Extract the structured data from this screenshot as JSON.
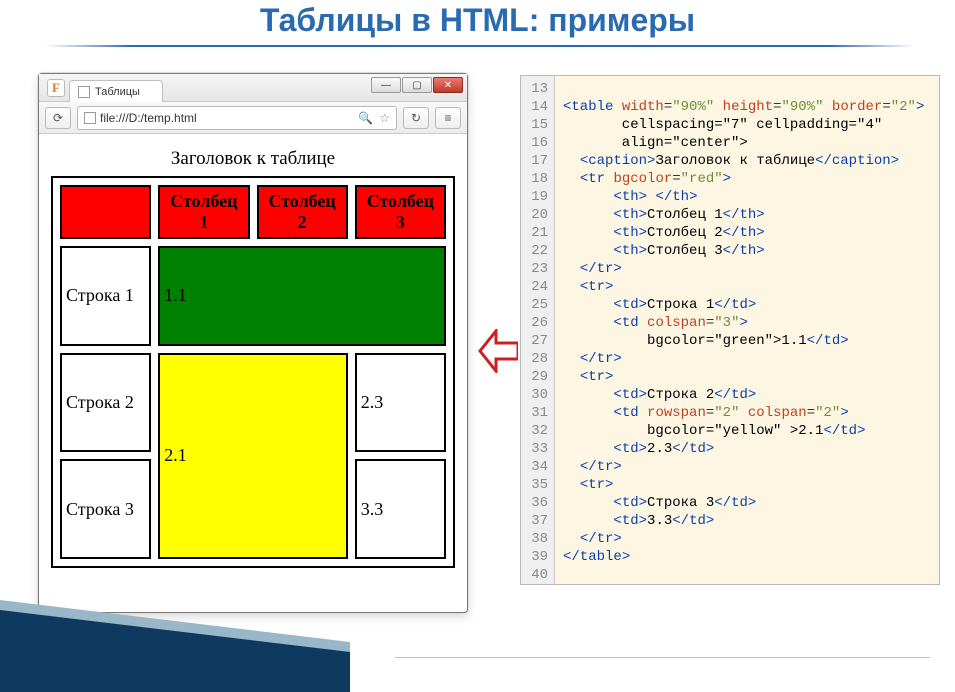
{
  "slide": {
    "title": "Таблицы в HTML: примеры"
  },
  "browser": {
    "favicon": "F",
    "tab_title": "Таблицы",
    "url": "file:///D:/temp.html",
    "reload_glyph": "⟳",
    "search_glyph": "🔍",
    "star_glyph": "☆",
    "menu_glyph": "≡",
    "loop_arrow": "↻"
  },
  "table": {
    "caption": "Заголовок к таблице",
    "headers": [
      "",
      "Столбец 1",
      "Столбец 2",
      "Столбец 3"
    ],
    "rows": [
      {
        "label": "Строка 1",
        "cells": [
          {
            "text": "1.1",
            "colspan": 3,
            "rowspan": 1,
            "class": "cell-green"
          }
        ]
      },
      {
        "label": "Строка 2",
        "cells": [
          {
            "text": "2.1",
            "colspan": 2,
            "rowspan": 2,
            "class": "cell-yellow"
          },
          {
            "text": "2.3",
            "colspan": 1,
            "rowspan": 1,
            "class": ""
          }
        ]
      },
      {
        "label": "Строка 3",
        "cells": [
          {
            "text": "3.3",
            "colspan": 1,
            "rowspan": 1,
            "class": ""
          }
        ]
      }
    ]
  },
  "code": {
    "first_line": 13,
    "lines": [
      "",
      "<table width=\"90%\" height=\"90%\" border=\"2\"",
      "       cellspacing=\"7\" cellpadding=\"4\"",
      "       align=\"center\">",
      "  <caption>Заголовок к таблице</caption>",
      "  <tr bgcolor=\"red\">",
      "      <th> </th>",
      "      <th>Столбец 1</th>",
      "      <th>Столбец 2</th>",
      "      <th>Столбец 3</th>",
      "  </tr>",
      "  <tr>",
      "      <td>Строка 1</td>",
      "      <td colspan=\"3\"",
      "          bgcolor=\"green\">1.1</td>",
      "  </tr>",
      "  <tr>",
      "      <td>Строка 2</td>",
      "      <td rowspan=\"2\" colspan=\"2\"",
      "          bgcolor=\"yellow\" >2.1</td>",
      "      <td>2.3</td>",
      "  </tr>",
      "  <tr>",
      "      <td>Строка 3</td>",
      "      <td>3.3</td>",
      "  </tr>",
      "</table>",
      ""
    ]
  }
}
